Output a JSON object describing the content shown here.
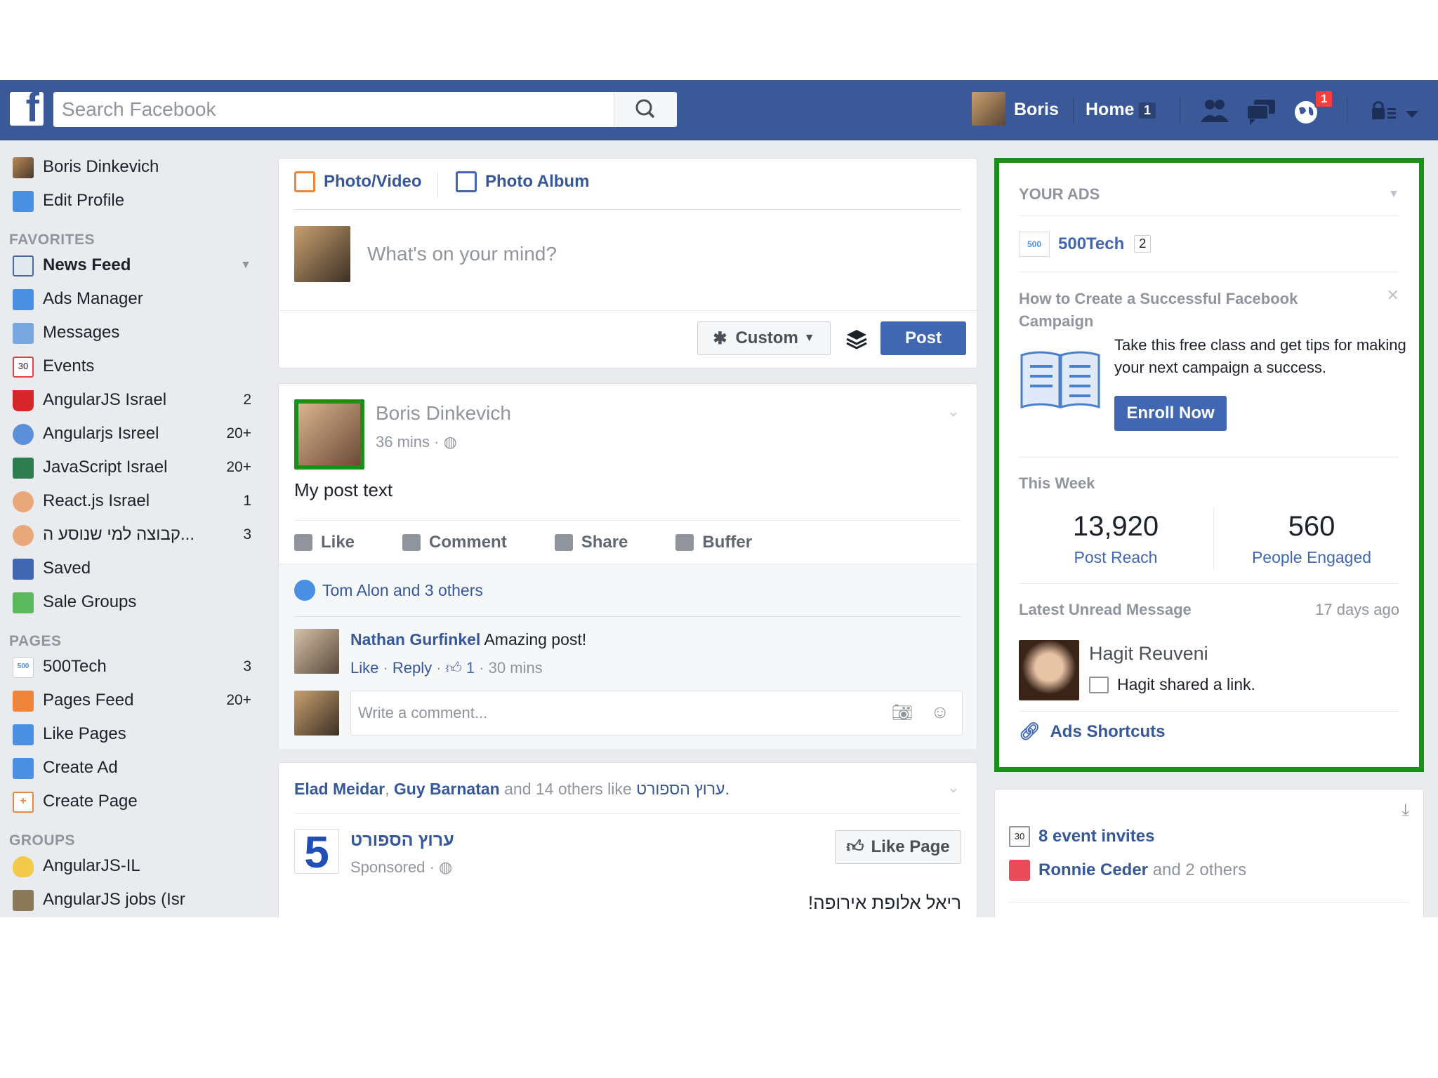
{
  "topbar": {
    "logo": "f",
    "search_placeholder": "Search Facebook",
    "user_name": "Boris",
    "home_label": "Home",
    "home_count": "1",
    "notifications_count": "1"
  },
  "left_nav": {
    "profile": [
      {
        "label": "Boris Dinkevich"
      },
      {
        "label": "Edit Profile"
      }
    ],
    "favorites_header": "FAVORITES",
    "favorites": [
      {
        "label": "News Feed",
        "count": ""
      },
      {
        "label": "Ads Manager",
        "count": ""
      },
      {
        "label": "Messages",
        "count": ""
      },
      {
        "label": "Events",
        "count": ""
      },
      {
        "label": "AngularJS Israel",
        "count": "2"
      },
      {
        "label": "Angularjs Isreel",
        "count": "20+"
      },
      {
        "label": "JavaScript Israel",
        "count": "20+"
      },
      {
        "label": "React.js Israel",
        "count": "1"
      },
      {
        "label": "קבוצה למי שנוסע ה...",
        "count": "3"
      },
      {
        "label": "Saved",
        "count": ""
      },
      {
        "label": "Sale Groups",
        "count": ""
      }
    ],
    "pages_header": "PAGES",
    "pages": [
      {
        "label": "500Tech",
        "count": "3"
      },
      {
        "label": "Pages Feed",
        "count": "20+"
      },
      {
        "label": "Like Pages",
        "count": ""
      },
      {
        "label": "Create Ad",
        "count": ""
      },
      {
        "label": "Create Page",
        "count": ""
      }
    ],
    "groups_header": "GROUPS",
    "groups": [
      {
        "label": "AngularJS-IL"
      },
      {
        "label": "AngularJS jobs (Isr"
      }
    ]
  },
  "composer": {
    "tab_photo_video": "Photo/Video",
    "tab_photo_album": "Photo Album",
    "placeholder": "What's on your mind?",
    "audience_label": "Custom",
    "post_button": "Post"
  },
  "post1": {
    "author": "Boris Dinkevich",
    "time": "36 mins",
    "text": "My post text",
    "actions": [
      "Like",
      "Comment",
      "Share",
      "Buffer"
    ],
    "likes_summary": "Tom Alon and 3 others",
    "comment": {
      "author": "Nathan Gurfinkel",
      "text": "Amazing post!",
      "like": "Like",
      "reply": "Reply",
      "likes": "1",
      "time": "30 mins"
    },
    "comment_placeholder": "Write a comment..."
  },
  "post2": {
    "liker1": "Elad Meidar",
    "liker2": "Guy Barnatan",
    "others_text": "and 14 others like",
    "page_ref": "ערוץ הספורט.",
    "page_name": "ערוץ הספורט",
    "sponsored": "Sponsored",
    "like_page": "Like Page",
    "body": "ריאל אלופת אירופה!"
  },
  "ads_panel": {
    "header": "YOUR ADS",
    "page_name": "500Tech",
    "page_count": "2",
    "ad_title": "How to Create a Successful Facebook Campaign",
    "ad_text": "Take this free class and get tips for making your next campaign a success.",
    "enroll": "Enroll Now",
    "this_week": "This Week",
    "reach_value": "13,920",
    "reach_label": "Post Reach",
    "engaged_value": "560",
    "engaged_label": "People Engaged",
    "latest_msg_label": "Latest Unread Message",
    "latest_msg_time": "17 days ago",
    "sender": "Hagit Reuveni",
    "msg_preview": "Hagit shared a link.",
    "shortcuts": "Ads Shortcuts"
  },
  "events_box": {
    "invites": "8 event invites",
    "birthday_name": "Ronnie Ceder",
    "birthday_rest": "and 2 others"
  },
  "colors": {
    "brand": "#3b5998",
    "link": "#365899",
    "button": "#4267b2",
    "highlight_border": "#1a8f1a",
    "badge": "#fa3e3e"
  }
}
